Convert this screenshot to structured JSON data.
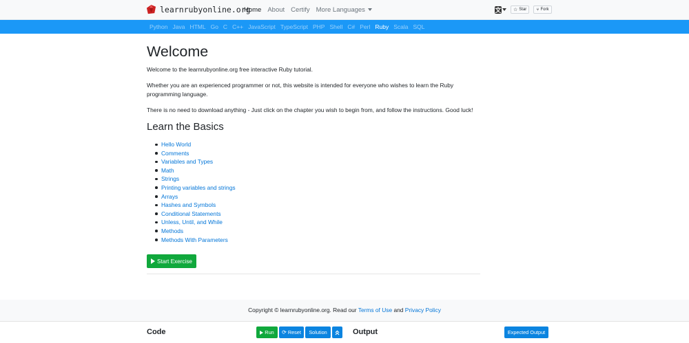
{
  "navbar": {
    "brand": "learnrubyonline.org",
    "links": [
      "Home",
      "About",
      "Certify",
      "More Languages"
    ],
    "active": "Home",
    "github_buttons": [
      "Star",
      "Fork"
    ]
  },
  "language_bar": {
    "languages": [
      "Python",
      "Java",
      "HTML",
      "Go",
      "C",
      "C++",
      "JavaScript",
      "TypeScript",
      "PHP",
      "Shell",
      "C#",
      "Perl",
      "Ruby",
      "Scala",
      "SQL"
    ],
    "active": "Ruby"
  },
  "main": {
    "title": "Welcome",
    "paragraphs": [
      "Welcome to the learnrubyonline.org free interactive Ruby tutorial.",
      "Whether you are an experienced programmer or not, this website is intended for everyone who wishes to learn the Ruby programming language.",
      "There is no need to download anything - Just click on the chapter you wish to begin from, and follow the instructions. Good luck!"
    ],
    "section_title": "Learn the Basics",
    "chapters": [
      "Hello World",
      "Comments",
      "Variables and Types",
      "Math",
      "Strings",
      "Printing variables and strings",
      "Arrays",
      "Hashes and Symbols",
      "Conditional Statements",
      "Unless, Until, and While",
      "Methods",
      "Methods With Parameters"
    ],
    "start_button": "Start Exercise"
  },
  "footer": {
    "prefix": "Copyright © learnrubyonline.org. Read our",
    "terms": "Terms of Use",
    "and": "and",
    "privacy": "Privacy Policy"
  },
  "codebar": {
    "code_label": "Code",
    "run": "Run",
    "reset": "Reset",
    "solution": "Solution",
    "output_label": "Output",
    "expected_output": "Expected Output"
  },
  "colors": {
    "language_bar": "#1b98f7",
    "link": "#0275d8",
    "success": "#10a83c",
    "primary_button": "#0b84e0",
    "logo": "#cc2222"
  },
  "icons": [
    "ruby-logo-icon",
    "language-icon",
    "star-icon",
    "fork-icon",
    "play-icon",
    "refresh-icon",
    "chevron-up-double-icon"
  ]
}
